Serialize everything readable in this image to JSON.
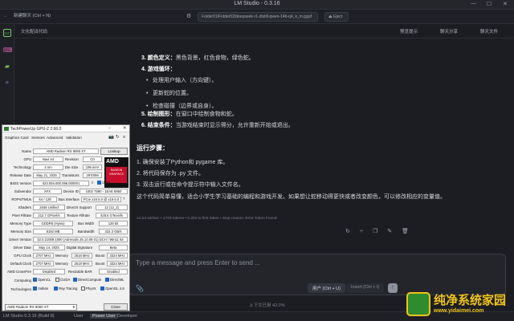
{
  "app": {
    "title": "LM Studio - 0.3.16",
    "minimize": "—",
    "maximize": "☐",
    "close": "✕"
  },
  "tabbar": {
    "new_chat_tab": "新建聊天 (Ctrl + N)",
    "model_path": "Folder01/Folder02/deepseek-r1-distill-qwen-14b-q4_k_m.gguf",
    "eject_label": "Eject"
  },
  "chat_header": {
    "title": "文化配译代码",
    "btn_preview": "预览提示",
    "btn_share": "聊天分享",
    "btn_collapse": "聊天文件"
  },
  "content": {
    "item3_label": "3. 颜色定义：",
    "item3_text": "黑色背景，红色食物，绿色蛇。",
    "item4_label": "4. 游戏循环：",
    "bullets": [
      "处理用户输入（方向键）。",
      "更新蛇的位置。",
      "检查碰撞（边界或自身）。"
    ],
    "item5_label": "5. 绘制图形：",
    "item5_text": "在窗口中绘制食物和蛇。",
    "item6_label": "6. 结束条件：",
    "item6_text": "当游戏结束时显示得分，允许重新开始或退出。",
    "steps_heading": "运行步骤：",
    "steps": [
      "1. 确保安装了Python和 pygame 库。",
      "2. 将代码保存为 .py 文件。",
      "3. 双击运行或在命令提示符中输入文件名。"
    ],
    "summary": "这个代码简单易懂，适合小学生学习基础的编程和游戏开发。如果想让蛇移动得更快或者改变颜色，可以修改相应的变量值。",
    "stats": "14.23 tok/sec • 1703 tokens • 0.20s to first token • Stop reason: EOS Token Found"
  },
  "input": {
    "placeholder": "Type a message and press Enter to send ...",
    "user_btn": "用户 (Ctrl + U)",
    "insert_btn": "Insert (Ctrl + I)",
    "context_usage": "上下文已用 42.0%"
  },
  "statusbar": {
    "app_version": "LM Studio 0.3.16 (Build 8)",
    "user": "User",
    "power_user": "Power User",
    "developer": "Developer"
  },
  "gpuz": {
    "title": "TechPowerUp GPU-Z 2.66.0",
    "tabs": [
      "Graphics Card",
      "Sensors",
      "Advanced",
      "Validation"
    ],
    "name": "AMD Radeon RX 9060 XT",
    "lookup": "Lookup",
    "gpu": "Navi 44",
    "revision": "C0",
    "technology": "4 nm",
    "die_size": "199 mm²",
    "release_date": "May 21, 2025",
    "transistors": "29700M",
    "bios_version": "023.004.000.066.000001",
    "uefi": "UEFI",
    "subvendor": "XFX",
    "device_id": "1002 7590 - 1EAE 8850",
    "rops_tmus": "64 / 128",
    "bus_interface": "PCIe x16 5.0 @ x16 5.0",
    "shaders": "2048 Unified",
    "directx_support": "12 (12_2)",
    "pixel_fillrate": "212.7 GPixel/s",
    "texture_fillrate": "425.5 GTexel/s",
    "memory_type": "GDDR6 (Hynix)",
    "bus_width": "128 bit",
    "memory_size": "8192 MB",
    "bandwidth": "322.3 GB/s",
    "driver_version": "32.0.21009.1000 (Adrenalin 25.10.08 01) DCH / Win11 64",
    "driver_date": "May 14, 2025",
    "digital_signature": "Beta",
    "gpu_clock": "2707 MHz",
    "memory_clock": "2518 MHz",
    "boost_clock": "3324 MHz",
    "default_clock": "2707 MHz",
    "default_memory": "2518 MHz",
    "default_boost": "3324 MHz",
    "crossfire": "Disabled",
    "resizable_bar": "Enabled",
    "computing": [
      "OpenCL",
      "CUDA",
      "DirectCompute",
      "DirectML"
    ],
    "technologies": [
      "Vulkan",
      "Ray Tracing",
      "PhysX",
      "OpenGL 4.6"
    ],
    "labels": {
      "name": "Name",
      "gpu": "GPU",
      "revision": "Revision",
      "technology": "Technology",
      "die_size": "Die Size",
      "release_date": "Release Date",
      "transistors": "Transistors",
      "bios": "BIOS Version",
      "subvendor": "Subvendor",
      "device_id": "Device ID",
      "rops": "ROPs/TMUs",
      "bus_interface": "Bus Interface",
      "shaders": "Shaders",
      "directx": "DirectX Support",
      "pixel": "Pixel Fillrate",
      "texture": "Texture Fillrate",
      "mem_type": "Memory Type",
      "bus_width": "Bus Width",
      "mem_size": "Memory Size",
      "bandwidth": "Bandwidth",
      "driver_version": "Driver Version",
      "driver_date": "Driver Date",
      "dig_sig": "Digital Signature",
      "gpu_clock": "GPU Clock",
      "memory": "Memory",
      "boost": "Boost",
      "default_clock": "Default Clock",
      "crossfire": "AMD CrossFire",
      "rebar": "Resizable BAR",
      "computing": "Computing",
      "technologies": "Technologies"
    },
    "selected_card": "AMD Radeon RX 9060 XT",
    "close": "Close",
    "logo_text": "AMD",
    "logo_sub": "RADEON GRAPHICS"
  },
  "watermark": {
    "main": "纯净系统家园",
    "sub": "www.yidaimei.com"
  },
  "colors": {
    "accent_green": "#7bd36b",
    "amd_red": "#c8102e",
    "watermark_yellow": "#f0c419"
  }
}
